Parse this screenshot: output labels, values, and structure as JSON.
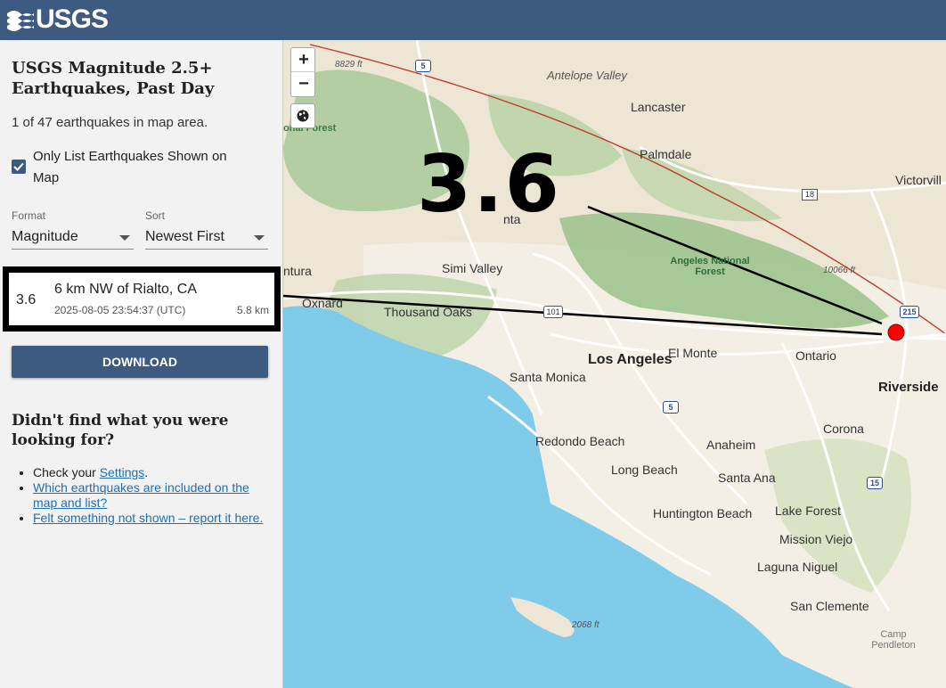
{
  "header": {
    "logo_text": "USGS"
  },
  "sidebar": {
    "title": "USGS Magnitude 2.5+ Earthquakes, Past Day",
    "count_text": "1 of 47 earthquakes in map area.",
    "only_list_label": "Only List Earthquakes Shown on Map",
    "format_label": "Format",
    "format_value": "Magnitude",
    "sort_label": "Sort",
    "sort_value": "Newest First",
    "earthquake": {
      "magnitude": "3.6",
      "place": "6 km NW of Rialto, CA",
      "time": "2025-08-05 23:54:37 (UTC)",
      "depth": "5.8 km"
    },
    "download_label": "DOWNLOAD",
    "help_title": "Didn't find what you were looking for?",
    "help_items": {
      "settings_prefix": "Check your ",
      "settings_link": "Settings",
      "settings_suffix": ".",
      "included_link": "Which earthquakes are included on the map and list?",
      "felt_link": "Felt something not shown – report it here."
    }
  },
  "map": {
    "zoom_in": "+",
    "zoom_out": "−",
    "magnitude_callout": "3.6",
    "places": {
      "antelope_valley": "Antelope Valley",
      "lancaster": "Lancaster",
      "palmdale": "Palmdale",
      "victorville": "Victorvill",
      "santa_clarita": "nta",
      "angeles_nf": "Angeles National Forest",
      "simi_valley": "Simi Valley",
      "ventura": "ntura",
      "oxnard": "Oxnard",
      "thousand_oaks": "Thousand Oaks",
      "los_angeles": "Los Angeles",
      "el_monte": "El Monte",
      "ontario": "Ontario",
      "riverside": "Riverside",
      "santa_monica": "Santa Monica",
      "corona": "Corona",
      "redondo_beach": "Redondo Beach",
      "anaheim": "Anaheim",
      "long_beach": "Long Beach",
      "santa_ana": "Santa Ana",
      "huntington_beach": "Huntington Beach",
      "lake_forest": "Lake Forest",
      "mission_viejo": "Mission Viejo",
      "laguna_niguel": "Laguna Niguel",
      "san_clemente": "San Clemente",
      "camp_pendleton": "Camp Pendleton",
      "los_padres_nf": "onal Forest",
      "elev_8829": "8829 ft",
      "elev_10066": "10066 ft",
      "elev_2068": "2068 ft"
    },
    "highways": {
      "i5_north": "5",
      "i5_south": "5",
      "i15": "15",
      "i215": "215",
      "hwy18": "18",
      "us101": "101"
    },
    "colors": {
      "ocean": "#7fcbea",
      "land": "#eee6d4",
      "forest": "#a9c99a",
      "fault": "#c0392b",
      "marker": "#ff0000"
    }
  }
}
